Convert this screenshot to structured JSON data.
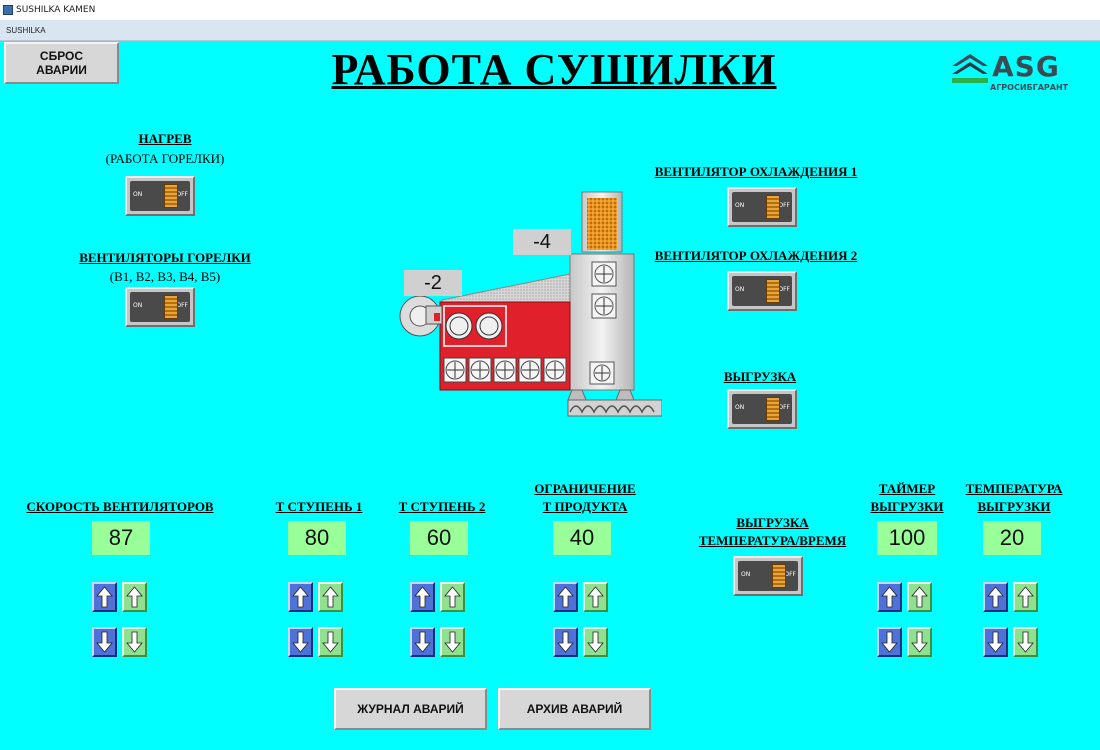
{
  "window": {
    "title": "SUSHILKA KAMEN",
    "menu": "SUSHILKA"
  },
  "header": {
    "reset_button": "СБРОС\nАВАРИИ",
    "title": "РАБОТА СУШИЛКИ"
  },
  "logo": {
    "brand": "ASG",
    "subtitle": "АГРОСИБГАРАНТ"
  },
  "left": {
    "heating": {
      "label": "НАГРЕВ",
      "sublabel": "(РАБОТА ГОРЕЛКИ)"
    },
    "burner_fans": {
      "label": "ВЕНТИЛЯТОРЫ ГОРЕЛКИ",
      "sublabel": "(В1, В2, В3, В4, В5)"
    }
  },
  "right": {
    "cooling_fan_1": {
      "label": "ВЕНТИЛЯТОР ОХЛАЖДЕНИЯ 1"
    },
    "cooling_fan_2": {
      "label": "ВЕНТИЛЯТОР ОХЛАЖДЕНИЯ 2"
    },
    "unloading": {
      "label": "ВЫГРУЗКА"
    }
  },
  "switch_text": {
    "on": "ON",
    "off": "OFF"
  },
  "dryer": {
    "readout_burner": "-2",
    "readout_top": "-4"
  },
  "setpoints": {
    "fan_speed": {
      "label": "СКОРОСТЬ ВЕНТИЛЯТОРОВ",
      "value": "87"
    },
    "t_stage_1": {
      "label": "Т СТУПЕНЬ 1",
      "value": "80"
    },
    "t_stage_2": {
      "label": "Т СТУПЕНЬ 2",
      "value": "60"
    },
    "product_limit": {
      "label_1": "ОГРАНИЧЕНИЕ",
      "label_2": "Т ПРОДУКТА",
      "value": "40"
    },
    "unload_mode": {
      "label_1": "ВЫГРУЗКА",
      "label_2": "ТЕМПЕРАТУРА/ВРЕМЯ"
    },
    "unload_timer": {
      "label_1": "ТАЙМЕР",
      "label_2": "ВЫГРУЗКИ",
      "value": "100"
    },
    "unload_temp": {
      "label_1": "ТЕМПЕРАТУРА",
      "label_2": "ВЫГРУЗКИ",
      "value": "20"
    }
  },
  "footer": {
    "alarm_log": "ЖУРНАЛ АВАРИЙ",
    "alarm_archive": "АРХИВ АВАРИЙ"
  },
  "colors": {
    "background": "#00ffff",
    "value_box": "#99ff99",
    "arrow_blue": "#4f72d8",
    "arrow_green": "#8fe08f",
    "dryer_red": "#e0202a"
  }
}
